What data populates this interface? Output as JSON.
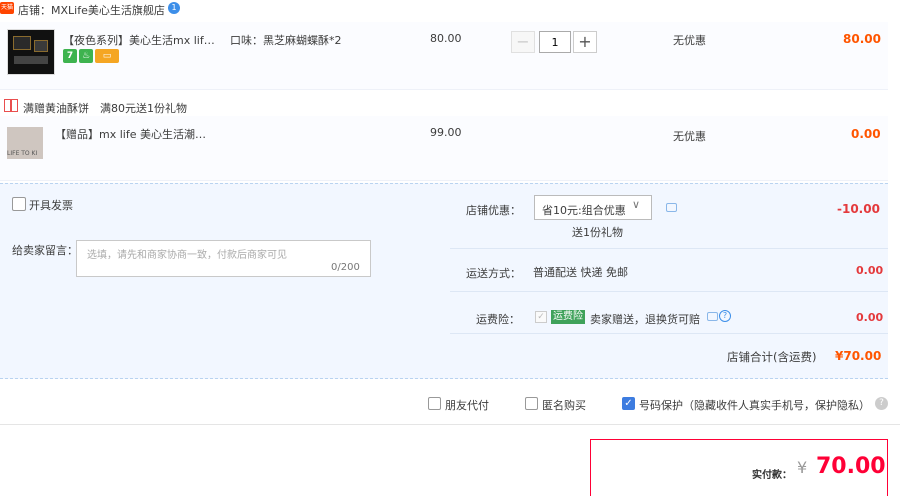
{
  "shop": {
    "badge": "天猫",
    "name": "店铺：MXLife美心生活旗舰店",
    "info_badge": "1"
  },
  "item1": {
    "title": "【夜色系列】美心生活mx life...",
    "tags": [
      "7",
      "♨",
      "▭"
    ],
    "sku": "口味：黑芝麻蝴蝶酥*2",
    "price": "80.00",
    "qty": "1",
    "qty_minus": "−",
    "qty_plus": "+",
    "discount": "无优惠",
    "total": "80.00"
  },
  "promo": {
    "text": "满赠黄油酥饼　满80元送1份礼物"
  },
  "item2": {
    "title": "【赠品】mx life 美心生活潮流...",
    "thumb_text": "LIFE TO KI",
    "price": "99.00",
    "discount": "无优惠",
    "total": "0.00"
  },
  "options": {
    "invoice_label": "开具发票",
    "message_label": "给卖家留言：",
    "message_placeholder": "选填，请先和商家协商一致，付款后商家可见",
    "message_count": "0/200"
  },
  "coupon": {
    "label": "店铺优惠：",
    "selected": "省10元:组合优惠",
    "chevron": "∨",
    "gift_note": "送1份礼物",
    "value": "-10.00"
  },
  "shipping": {
    "label": "运送方式：",
    "method": "普通配送 快递 免邮",
    "value": "0.00"
  },
  "insurance": {
    "label": "运费险：",
    "check": "✓",
    "badge": "运费险",
    "text": "卖家赠送，退换货可赔",
    "help": "?",
    "value": "0.00"
  },
  "shop_total": {
    "label": "店铺合计(含运费)",
    "value": "¥70.00"
  },
  "checkboxes": {
    "friend_pay": "朋友代付",
    "anonymous": "匿名购买",
    "phone_protect": "号码保护（隐藏收件人真实手机号，保护隐私）",
    "checked_mark": "✓",
    "help": "?"
  },
  "payment": {
    "label": "实付款：",
    "currency": "¥",
    "amount": "70.00"
  },
  "colors": {
    "price_orange": "#ff5500",
    "accent_red": "#ff0036",
    "panel_bg": "#f2f7ff",
    "checkbox_blue": "#3d7ce0"
  }
}
